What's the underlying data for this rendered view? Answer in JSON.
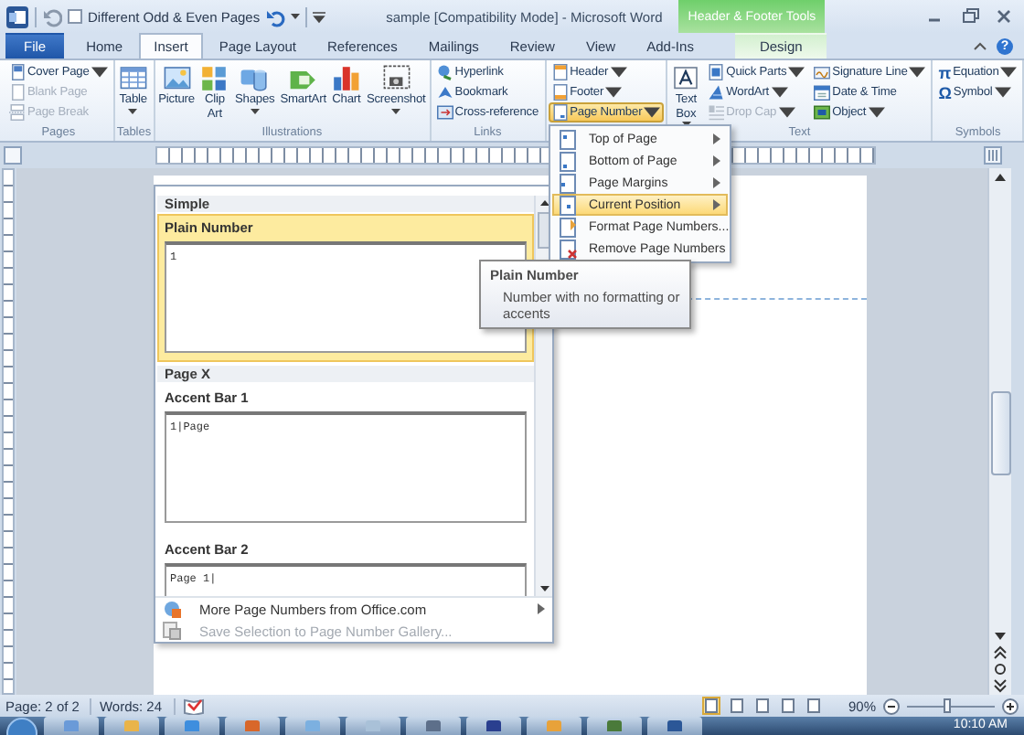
{
  "title_bar": {
    "quick_access_checkbox": {
      "label": "Different Odd & Even Pages",
      "checked": false
    },
    "title": "sample [Compatibility Mode] - Microsoft Word",
    "context_header": "Header & Footer Tools"
  },
  "tabs": [
    {
      "label": "File",
      "kind": "file",
      "selected": false
    },
    {
      "label": "Home",
      "kind": "tab",
      "selected": false
    },
    {
      "label": "Insert",
      "kind": "tab",
      "selected": true
    },
    {
      "label": "Page Layout",
      "kind": "tab",
      "selected": false
    },
    {
      "label": "References",
      "kind": "tab",
      "selected": false
    },
    {
      "label": "Mailings",
      "kind": "tab",
      "selected": false
    },
    {
      "label": "Review",
      "kind": "tab",
      "selected": false
    },
    {
      "label": "View",
      "kind": "tab",
      "selected": false
    },
    {
      "label": "Add-Ins",
      "kind": "tab",
      "selected": false
    },
    {
      "label": "Design",
      "kind": "context",
      "selected": false
    }
  ],
  "help": "?",
  "ribbon_groups": [
    {
      "label": "Pages",
      "items": [
        {
          "label": "Cover Page",
          "kind": "small",
          "dropdown": true,
          "disabled": false
        },
        {
          "label": "Blank Page",
          "kind": "small",
          "dropdown": false,
          "disabled": true
        },
        {
          "label": "Page Break",
          "kind": "small",
          "dropdown": false,
          "disabled": true
        }
      ]
    },
    {
      "label": "Tables",
      "items": [
        {
          "label": "Table",
          "kind": "large",
          "dropdown": true,
          "disabled": false
        }
      ]
    },
    {
      "label": "Illustrations",
      "items": [
        {
          "label": "Picture",
          "kind": "large",
          "dropdown": false,
          "disabled": false
        },
        {
          "label": "Clip Art",
          "kind": "large",
          "dropdown": false,
          "disabled": false
        },
        {
          "label": "Shapes",
          "kind": "large",
          "dropdown": true,
          "disabled": false
        },
        {
          "label": "SmartArt",
          "kind": "large",
          "dropdown": false,
          "disabled": false
        },
        {
          "label": "Chart",
          "kind": "large",
          "dropdown": false,
          "disabled": false
        },
        {
          "label": "Screenshot",
          "kind": "large",
          "dropdown": true,
          "disabled": false
        }
      ]
    },
    {
      "label": "Links",
      "items": [
        {
          "label": "Hyperlink",
          "kind": "small",
          "dropdown": false,
          "disabled": false
        },
        {
          "label": "Bookmark",
          "kind": "small",
          "dropdown": false,
          "disabled": false
        },
        {
          "label": "Cross-reference",
          "kind": "small",
          "dropdown": false,
          "disabled": false
        }
      ]
    },
    {
      "items": [
        {
          "label": "Header",
          "kind": "small",
          "dropdown": true,
          "disabled": false,
          "open": false
        },
        {
          "label": "Footer",
          "kind": "small",
          "dropdown": true,
          "disabled": false,
          "open": false
        },
        {
          "label": "Page Number",
          "kind": "small",
          "dropdown": true,
          "disabled": false,
          "open": true
        }
      ]
    },
    {
      "label": "Text",
      "items": [
        {
          "label": "Text Box",
          "kind": "large",
          "dropdown": true,
          "disabled": false
        },
        {
          "label": "Quick Parts",
          "kind": "small",
          "dropdown": true,
          "disabled": false
        },
        {
          "label": "WordArt",
          "kind": "small",
          "dropdown": true,
          "disabled": false
        },
        {
          "label": "Drop Cap",
          "kind": "small",
          "dropdown": true,
          "disabled": true
        },
        {
          "label": "Signature Line",
          "kind": "small",
          "dropdown": true,
          "disabled": false
        },
        {
          "label": "Date & Time",
          "kind": "small",
          "dropdown": false,
          "disabled": false
        },
        {
          "label": "Object",
          "kind": "small",
          "dropdown": true,
          "disabled": false
        }
      ]
    },
    {
      "label": "Symbols",
      "items": [
        {
          "label": "Equation",
          "kind": "small",
          "dropdown": true,
          "disabled": false,
          "glyph": "π"
        },
        {
          "label": "Symbol",
          "kind": "small",
          "dropdown": true,
          "disabled": false,
          "glyph": "Ω"
        }
      ]
    }
  ],
  "page_number_menu": [
    {
      "label": "Top of Page",
      "submenu": true,
      "selected": false
    },
    {
      "label": "Bottom of Page",
      "submenu": true,
      "selected": false
    },
    {
      "label": "Page Margins",
      "submenu": true,
      "selected": false
    },
    {
      "label": "Current Position",
      "submenu": true,
      "selected": true
    },
    {
      "label": "Format Page Numbers...",
      "submenu": false,
      "selected": false
    },
    {
      "label": "Remove Page Numbers",
      "submenu": false,
      "selected": false
    }
  ],
  "gallery": {
    "sections": [
      {
        "heading": "Simple",
        "entries": [
          {
            "label": "Plain Number",
            "preview": "1",
            "selected": true
          }
        ]
      },
      {
        "heading": "Page X",
        "entries": [
          {
            "label": "Accent Bar 1",
            "preview": "1|Page",
            "selected": false
          },
          {
            "label": "Accent Bar 2",
            "preview": "Page 1|",
            "selected": false
          }
        ]
      }
    ],
    "footer_items": [
      {
        "label": "More Page Numbers from Office.com",
        "submenu": true,
        "disabled": false
      },
      {
        "label": "Save Selection to Page Number Gallery...",
        "submenu": false,
        "disabled": true
      }
    ]
  },
  "tooltip": {
    "title": "Plain Number",
    "text": "Number with no formatting or accents"
  },
  "status_bar": {
    "page": "Page: 2 of 2",
    "words": "Words: 24",
    "views": [
      {
        "selected": true
      },
      {
        "selected": false
      },
      {
        "selected": false
      },
      {
        "selected": false
      },
      {
        "selected": false
      }
    ],
    "zoom": "90%",
    "zoom_slider": {
      "level": 0.45
    }
  },
  "taskbar": {
    "clock": "10:10 AM"
  }
}
